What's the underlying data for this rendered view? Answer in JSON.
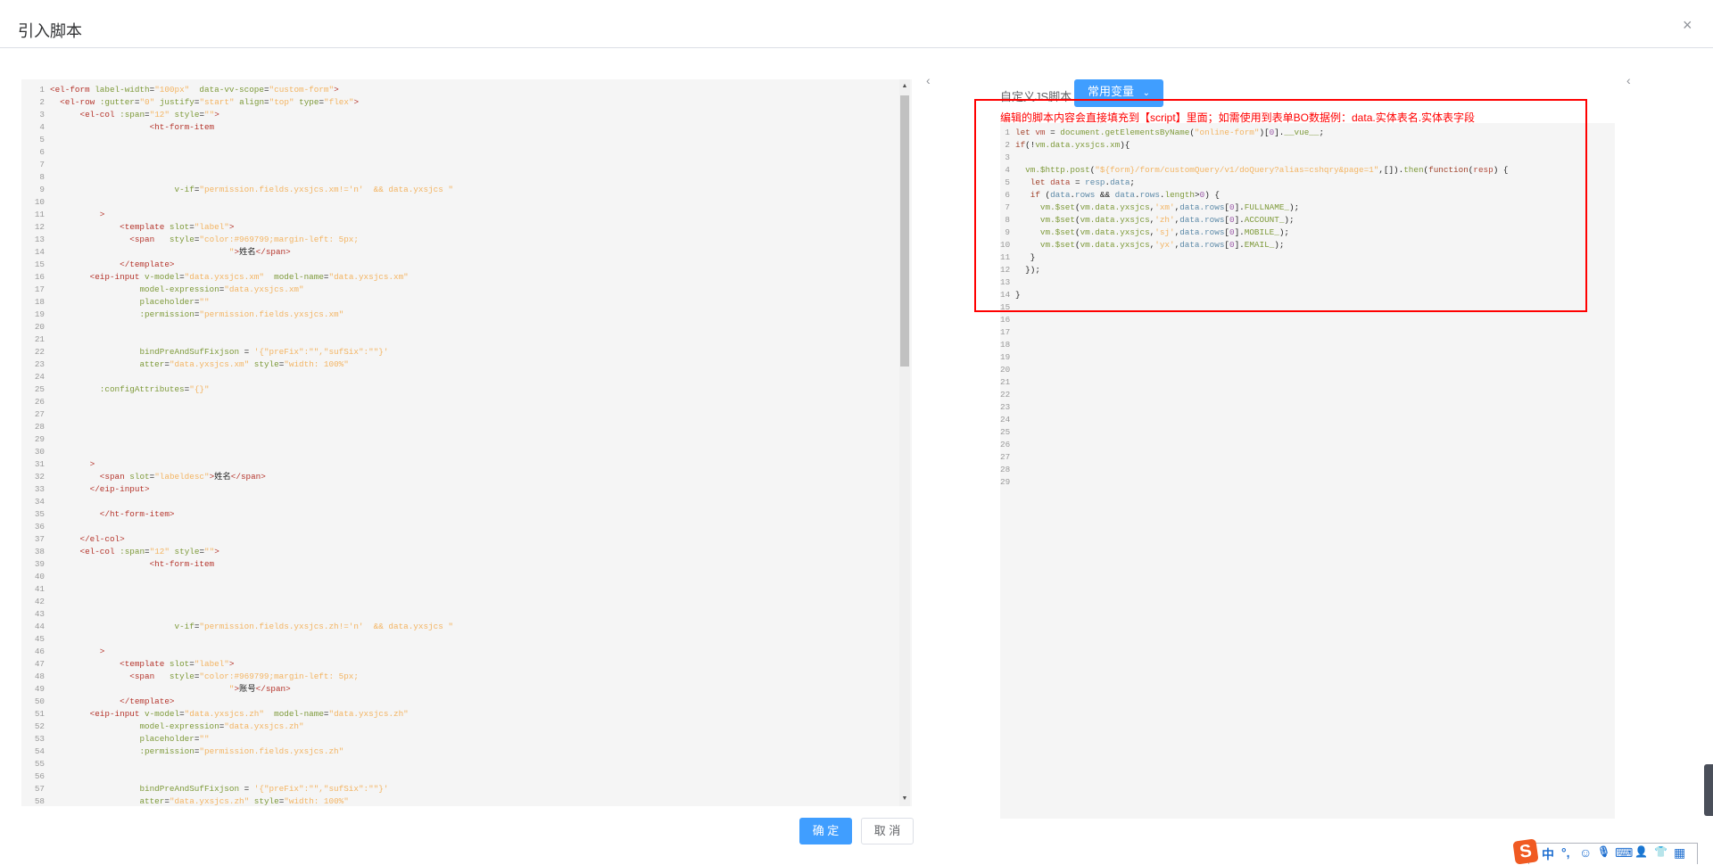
{
  "dialog": {
    "title": "引入脚本",
    "close_icon": "×"
  },
  "left_editor": {
    "lines": [
      [
        [
          "t",
          "<el-form "
        ],
        [
          "a",
          "label-width"
        ],
        [
          "p",
          "="
        ],
        [
          "s",
          "\"100px\""
        ],
        [
          "p",
          "  "
        ],
        [
          "a",
          "data-vv-scope"
        ],
        [
          "p",
          "="
        ],
        [
          "s",
          "\"custom-form\""
        ],
        [
          "t",
          ">"
        ]
      ],
      [
        [
          "p",
          "  "
        ],
        [
          "t",
          "<el-row "
        ],
        [
          "a",
          ":gutter"
        ],
        [
          "p",
          "="
        ],
        [
          "s",
          "\"0\""
        ],
        [
          "p",
          " "
        ],
        [
          "a",
          "justify"
        ],
        [
          "p",
          "="
        ],
        [
          "s",
          "\"start\""
        ],
        [
          "p",
          " "
        ],
        [
          "a",
          "align"
        ],
        [
          "p",
          "="
        ],
        [
          "s",
          "\"top\""
        ],
        [
          "p",
          " "
        ],
        [
          "a",
          "type"
        ],
        [
          "p",
          "="
        ],
        [
          "s",
          "\"flex\""
        ],
        [
          "t",
          ">"
        ]
      ],
      [
        [
          "p",
          "      "
        ],
        [
          "t",
          "<el-col "
        ],
        [
          "a",
          ":span"
        ],
        [
          "p",
          "="
        ],
        [
          "s",
          "\"12\""
        ],
        [
          "p",
          " "
        ],
        [
          "a",
          "style"
        ],
        [
          "p",
          "="
        ],
        [
          "s",
          "\"\""
        ],
        [
          "t",
          ">"
        ]
      ],
      [
        [
          "p",
          "                    "
        ],
        [
          "t",
          "<ht-form-item"
        ]
      ],
      [],
      [],
      [],
      [],
      [
        [
          "p",
          "                         "
        ],
        [
          "a",
          "v-if"
        ],
        [
          "p",
          "="
        ],
        [
          "s",
          "\"permission.fields.yxsjcs.xm!='n'  && data.yxsjcs \""
        ]
      ],
      [],
      [
        [
          "p",
          "          "
        ],
        [
          "t",
          ">"
        ]
      ],
      [
        [
          "p",
          "              "
        ],
        [
          "t",
          "<template "
        ],
        [
          "a",
          "slot"
        ],
        [
          "p",
          "="
        ],
        [
          "s",
          "\"label\""
        ],
        [
          "t",
          ">"
        ]
      ],
      [
        [
          "p",
          "                "
        ],
        [
          "t",
          "<span   "
        ],
        [
          "a",
          "style"
        ],
        [
          "p",
          "="
        ],
        [
          "s",
          "\"color:#969799;margin-left: 5px;"
        ]
      ],
      [
        [
          "p",
          "                                    "
        ],
        [
          "s",
          "\""
        ],
        [
          "t",
          ">"
        ],
        [
          "p",
          "姓名"
        ],
        [
          "t",
          "</span>"
        ]
      ],
      [
        [
          "p",
          "              "
        ],
        [
          "t",
          "</template>"
        ]
      ],
      [
        [
          "p",
          "        "
        ],
        [
          "t",
          "<eip-input "
        ],
        [
          "a",
          "v-model"
        ],
        [
          "p",
          "="
        ],
        [
          "s",
          "\"data.yxsjcs.xm\""
        ],
        [
          "p",
          "  "
        ],
        [
          "a",
          "model-name"
        ],
        [
          "p",
          "="
        ],
        [
          "s",
          "\"data.yxsjcs.xm\""
        ]
      ],
      [
        [
          "p",
          "                  "
        ],
        [
          "a",
          "model-expression"
        ],
        [
          "p",
          "="
        ],
        [
          "s",
          "\"data.yxsjcs.xm\""
        ]
      ],
      [
        [
          "p",
          "                  "
        ],
        [
          "a",
          "placeholder"
        ],
        [
          "p",
          "="
        ],
        [
          "s",
          "\"\""
        ]
      ],
      [
        [
          "p",
          "                  "
        ],
        [
          "a",
          ":permission"
        ],
        [
          "p",
          "="
        ],
        [
          "s",
          "\"permission.fields.yxsjcs.xm\""
        ]
      ],
      [],
      [],
      [
        [
          "p",
          "                  "
        ],
        [
          "a",
          "bindPreAndSufFixjson"
        ],
        [
          "p",
          " = "
        ],
        [
          "s",
          "'{\"preFix\":\"\",\"sufSix\":\"\"}'"
        ]
      ],
      [
        [
          "p",
          "                  "
        ],
        [
          "a",
          "atter"
        ],
        [
          "p",
          "="
        ],
        [
          "s",
          "\"data.yxsjcs.xm\""
        ],
        [
          "p",
          " "
        ],
        [
          "a",
          "style"
        ],
        [
          "p",
          "="
        ],
        [
          "s",
          "\"width: 100%\""
        ]
      ],
      [],
      [
        [
          "p",
          "          "
        ],
        [
          "a",
          ":configAttributes"
        ],
        [
          "p",
          "="
        ],
        [
          "s",
          "\"{}\""
        ]
      ],
      [],
      [],
      [],
      [],
      [],
      [
        [
          "p",
          "        "
        ],
        [
          "t",
          ">"
        ]
      ],
      [
        [
          "p",
          "          "
        ],
        [
          "t",
          "<span "
        ],
        [
          "a",
          "slot"
        ],
        [
          "p",
          "="
        ],
        [
          "s",
          "\"labeldesc\""
        ],
        [
          "t",
          ">"
        ],
        [
          "p",
          "姓名"
        ],
        [
          "t",
          "</span>"
        ]
      ],
      [
        [
          "p",
          "        "
        ],
        [
          "t",
          "</eip-input>"
        ]
      ],
      [],
      [
        [
          "p",
          "          "
        ],
        [
          "t",
          "</ht-form-item>"
        ]
      ],
      [],
      [
        [
          "p",
          "      "
        ],
        [
          "t",
          "</el-col>"
        ]
      ],
      [
        [
          "p",
          "      "
        ],
        [
          "t",
          "<el-col "
        ],
        [
          "a",
          ":span"
        ],
        [
          "p",
          "="
        ],
        [
          "s",
          "\"12\""
        ],
        [
          "p",
          " "
        ],
        [
          "a",
          "style"
        ],
        [
          "p",
          "="
        ],
        [
          "s",
          "\"\""
        ],
        [
          "t",
          ">"
        ]
      ],
      [
        [
          "p",
          "                    "
        ],
        [
          "t",
          "<ht-form-item"
        ]
      ],
      [],
      [],
      [],
      [],
      [
        [
          "p",
          "                         "
        ],
        [
          "a",
          "v-if"
        ],
        [
          "p",
          "="
        ],
        [
          "s",
          "\"permission.fields.yxsjcs.zh!='n'  && data.yxsjcs \""
        ]
      ],
      [],
      [
        [
          "p",
          "          "
        ],
        [
          "t",
          ">"
        ]
      ],
      [
        [
          "p",
          "              "
        ],
        [
          "t",
          "<template "
        ],
        [
          "a",
          "slot"
        ],
        [
          "p",
          "="
        ],
        [
          "s",
          "\"label\""
        ],
        [
          "t",
          ">"
        ]
      ],
      [
        [
          "p",
          "                "
        ],
        [
          "t",
          "<span   "
        ],
        [
          "a",
          "style"
        ],
        [
          "p",
          "="
        ],
        [
          "s",
          "\"color:#969799;margin-left: 5px;"
        ]
      ],
      [
        [
          "p",
          "                                    "
        ],
        [
          "s",
          "\""
        ],
        [
          "t",
          ">"
        ],
        [
          "p",
          "账号"
        ],
        [
          "t",
          "</span>"
        ]
      ],
      [
        [
          "p",
          "              "
        ],
        [
          "t",
          "</template>"
        ]
      ],
      [
        [
          "p",
          "        "
        ],
        [
          "t",
          "<eip-input "
        ],
        [
          "a",
          "v-model"
        ],
        [
          "p",
          "="
        ],
        [
          "s",
          "\"data.yxsjcs.zh\""
        ],
        [
          "p",
          "  "
        ],
        [
          "a",
          "model-name"
        ],
        [
          "p",
          "="
        ],
        [
          "s",
          "\"data.yxsjcs.zh\""
        ]
      ],
      [
        [
          "p",
          "                  "
        ],
        [
          "a",
          "model-expression"
        ],
        [
          "p",
          "="
        ],
        [
          "s",
          "\"data.yxsjcs.zh\""
        ]
      ],
      [
        [
          "p",
          "                  "
        ],
        [
          "a",
          "placeholder"
        ],
        [
          "p",
          "="
        ],
        [
          "s",
          "\"\""
        ]
      ],
      [
        [
          "p",
          "                  "
        ],
        [
          "a",
          ":permission"
        ],
        [
          "p",
          "="
        ],
        [
          "s",
          "\"permission.fields.yxsjcs.zh\""
        ]
      ],
      [],
      [],
      [
        [
          "p",
          "                  "
        ],
        [
          "a",
          "bindPreAndSufFixjson"
        ],
        [
          "p",
          " = "
        ],
        [
          "s",
          "'{\"preFix\":\"\",\"sufSix\":\"\"}'"
        ]
      ],
      [
        [
          "p",
          "                  "
        ],
        [
          "a",
          "atter"
        ],
        [
          "p",
          "="
        ],
        [
          "s",
          "\"data.yxsjcs.zh\""
        ],
        [
          "p",
          " "
        ],
        [
          "a",
          "style"
        ],
        [
          "p",
          "="
        ],
        [
          "s",
          "\"width: 100%\""
        ]
      ]
    ]
  },
  "right_panel": {
    "label": "自定义JS脚本",
    "variables_button": "常用变量",
    "notice": "编辑的脚本内容会直接填充到【script】里面；如需使用到表单BO数据例：data.实体表名.实体表字段",
    "highlight_color": "#ff0000",
    "lines": [
      [
        [
          "k",
          "let "
        ],
        [
          "v",
          "vm"
        ],
        [
          "p",
          " = "
        ],
        [
          "a",
          "document.getElementsByName"
        ],
        [
          "p",
          "("
        ],
        [
          "s",
          "\"online-form\""
        ],
        [
          "p",
          ")["
        ],
        [
          "n",
          "0"
        ],
        [
          "p",
          "]."
        ],
        [
          "a",
          "__vue__"
        ],
        [
          "p",
          ";"
        ]
      ],
      [
        [
          "k",
          "if"
        ],
        [
          "p",
          "(!"
        ],
        [
          "a",
          "vm.data.yxsjcs.xm"
        ],
        [
          "p",
          "){"
        ]
      ],
      [],
      [
        [
          "p",
          "  "
        ],
        [
          "a",
          "vm.$http.post"
        ],
        [
          "p",
          "("
        ],
        [
          "s",
          "\"${form}/form/customQuery/v1/doQuery?alias=cshqry&page=1\""
        ],
        [
          "p",
          ",[])."
        ],
        [
          "a",
          "then"
        ],
        [
          "p",
          "("
        ],
        [
          "k",
          "function"
        ],
        [
          "p",
          "("
        ],
        [
          "v",
          "resp"
        ],
        [
          "p",
          ") {"
        ]
      ],
      [
        [
          "p",
          "   "
        ],
        [
          "k",
          "let "
        ],
        [
          "v",
          "data"
        ],
        [
          "p",
          " = "
        ],
        [
          "b",
          "resp"
        ],
        [
          "p",
          "."
        ],
        [
          "b",
          "data"
        ],
        [
          "p",
          ";"
        ]
      ],
      [
        [
          "p",
          "   "
        ],
        [
          "k",
          "if "
        ],
        [
          "p",
          "("
        ],
        [
          "b",
          "data"
        ],
        [
          "p",
          "."
        ],
        [
          "b",
          "rows"
        ],
        [
          "p",
          " && "
        ],
        [
          "b",
          "data"
        ],
        [
          "p",
          "."
        ],
        [
          "b",
          "rows"
        ],
        [
          "p",
          "."
        ],
        [
          "a",
          "length"
        ],
        [
          "p",
          ">"
        ],
        [
          "n",
          "0"
        ],
        [
          "p",
          ") {"
        ]
      ],
      [
        [
          "p",
          "     "
        ],
        [
          "a",
          "vm.$set"
        ],
        [
          "p",
          "("
        ],
        [
          "a",
          "vm.data.yxsjcs"
        ],
        [
          "p",
          ","
        ],
        [
          "s",
          "'xm'"
        ],
        [
          "p",
          ","
        ],
        [
          "b",
          "data.rows"
        ],
        [
          "p",
          "["
        ],
        [
          "n",
          "0"
        ],
        [
          "p",
          "]."
        ],
        [
          "a",
          "FULLNAME_"
        ],
        [
          "p",
          ");"
        ]
      ],
      [
        [
          "p",
          "     "
        ],
        [
          "a",
          "vm.$set"
        ],
        [
          "p",
          "("
        ],
        [
          "a",
          "vm.data.yxsjcs"
        ],
        [
          "p",
          ","
        ],
        [
          "s",
          "'zh'"
        ],
        [
          "p",
          ","
        ],
        [
          "b",
          "data.rows"
        ],
        [
          "p",
          "["
        ],
        [
          "n",
          "0"
        ],
        [
          "p",
          "]."
        ],
        [
          "a",
          "ACCOUNT_"
        ],
        [
          "p",
          ");"
        ]
      ],
      [
        [
          "p",
          "     "
        ],
        [
          "a",
          "vm.$set"
        ],
        [
          "p",
          "("
        ],
        [
          "a",
          "vm.data.yxsjcs"
        ],
        [
          "p",
          ","
        ],
        [
          "s",
          "'sj'"
        ],
        [
          "p",
          ","
        ],
        [
          "b",
          "data.rows"
        ],
        [
          "p",
          "["
        ],
        [
          "n",
          "0"
        ],
        [
          "p",
          "]."
        ],
        [
          "a",
          "MOBILE_"
        ],
        [
          "p",
          ");"
        ]
      ],
      [
        [
          "p",
          "     "
        ],
        [
          "a",
          "vm.$set"
        ],
        [
          "p",
          "("
        ],
        [
          "a",
          "vm.data.yxsjcs"
        ],
        [
          "p",
          ","
        ],
        [
          "s",
          "'yx'"
        ],
        [
          "p",
          ","
        ],
        [
          "b",
          "data.rows"
        ],
        [
          "p",
          "["
        ],
        [
          "n",
          "0"
        ],
        [
          "p",
          "]."
        ],
        [
          "a",
          "EMAIL_"
        ],
        [
          "p",
          ");"
        ]
      ],
      [
        [
          "p",
          "   }"
        ]
      ],
      [
        [
          "p",
          "  });"
        ]
      ],
      [],
      [
        [
          "p",
          "}"
        ]
      ],
      [],
      [],
      [],
      [],
      [],
      [],
      [],
      [],
      [],
      [],
      [],
      [],
      [],
      [],
      []
    ]
  },
  "footer": {
    "confirm": "确 定",
    "cancel": "取 消"
  },
  "ime_toolbar": {
    "logo": "S",
    "items": [
      "中",
      "°,",
      "☺",
      "🎙",
      "⌨",
      "👤",
      "👕",
      "▦"
    ]
  },
  "colors": {
    "primary": "#409eff",
    "editor_bg": "#f5f5f5"
  }
}
